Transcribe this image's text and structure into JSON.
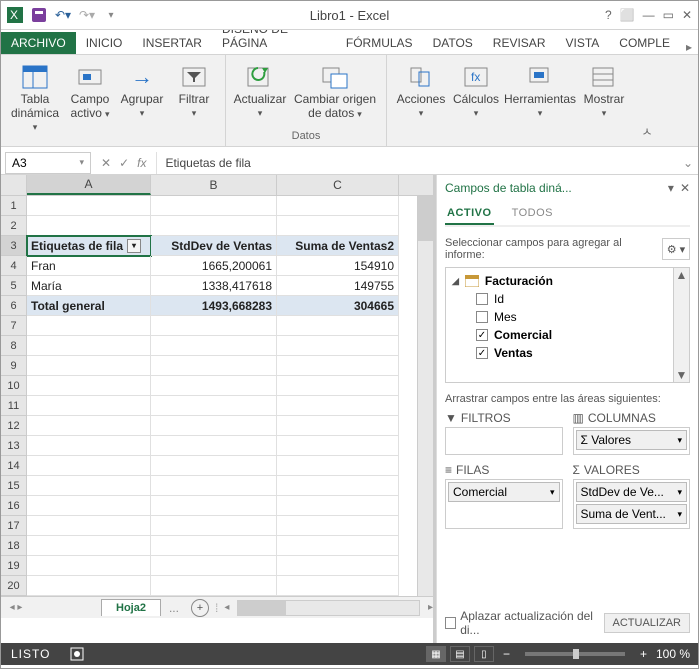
{
  "window": {
    "title": "Libro1 - Excel"
  },
  "ribbon": {
    "tabs": [
      "ARCHIVO",
      "INICIO",
      "INSERTAR",
      "DISEÑO DE PÁGINA",
      "FÓRMULAS",
      "DATOS",
      "REVISAR",
      "VISTA",
      "COMPLE"
    ],
    "active_index": 0,
    "groups": {
      "g1": [
        {
          "label": "Tabla dinámica",
          "arrow": true
        },
        {
          "label": "Campo activo",
          "arrow": true
        },
        {
          "label": "Agrupar",
          "arrow": true
        },
        {
          "label": "Filtrar",
          "arrow": true
        }
      ],
      "data": {
        "label": "Datos",
        "items": [
          {
            "label": "Actualizar",
            "arrow": true
          },
          {
            "label": "Cambiar origen de datos",
            "arrow": true
          }
        ]
      },
      "others": [
        {
          "label": "Acciones",
          "arrow": true
        },
        {
          "label": "Cálculos",
          "arrow": true
        },
        {
          "label": "Herramientas",
          "arrow": true
        },
        {
          "label": "Mostrar",
          "arrow": true
        }
      ]
    }
  },
  "formula_bar": {
    "name_box": "A3",
    "value": "Etiquetas de fila",
    "fx": "fx"
  },
  "grid": {
    "columns": [
      "A",
      "B",
      "C"
    ],
    "header_row_index": 3,
    "headers": [
      "Etiquetas de fila",
      "StdDev de Ventas",
      "Suma de Ventas2"
    ],
    "rows": [
      {
        "n": 4,
        "a": "Fran",
        "b": "1665,200061",
        "c": "154910"
      },
      {
        "n": 5,
        "a": "María",
        "b": "1338,417618",
        "c": "149755"
      }
    ],
    "total": {
      "n": 6,
      "a": "Total general",
      "b": "1493,668283",
      "c": "304665"
    },
    "empty_rows": [
      7,
      8,
      9,
      10,
      11,
      12,
      13,
      14,
      15,
      16,
      17,
      18,
      19,
      20
    ]
  },
  "sheets": {
    "active": "Hoja2",
    "more": "..."
  },
  "taskpane": {
    "title": "Campos de tabla diná...",
    "tabs": {
      "active": "ACTIVO",
      "all": "TODOS"
    },
    "instruction": "Seleccionar campos para agregar al informe:",
    "table": "Facturación",
    "fields": [
      {
        "name": "Id",
        "checked": false,
        "bold": false
      },
      {
        "name": "Mes",
        "checked": false,
        "bold": false
      },
      {
        "name": "Comercial",
        "checked": true,
        "bold": true
      },
      {
        "name": "Ventas",
        "checked": true,
        "bold": true
      }
    ],
    "drag_label": "Arrastrar campos entre las áreas siguientes:",
    "areas": {
      "filters": {
        "title": "FILTROS",
        "items": []
      },
      "columns": {
        "title": "COLUMNAS",
        "items": [
          "Σ  Valores"
        ]
      },
      "rows": {
        "title": "FILAS",
        "items": [
          "Comercial"
        ]
      },
      "values": {
        "title": "VALORES",
        "items": [
          "StdDev de Ve...",
          "Suma de Vent..."
        ]
      }
    },
    "defer": "Aplazar actualización del di...",
    "update": "ACTUALIZAR"
  },
  "statusbar": {
    "left": "LISTO",
    "zoom": "100 %"
  }
}
